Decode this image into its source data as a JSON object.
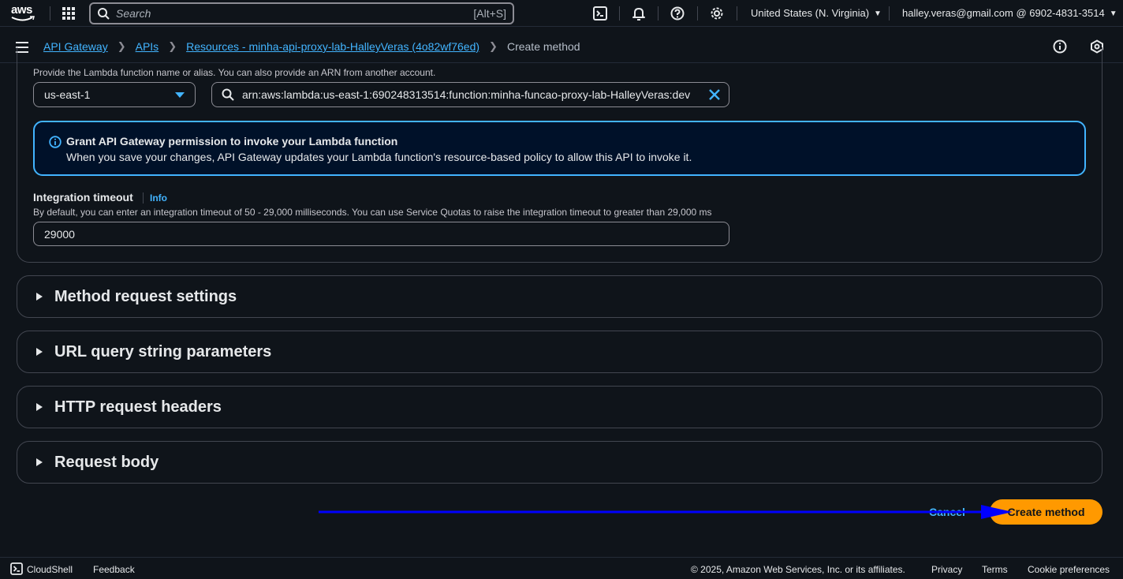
{
  "topnav": {
    "logo": "aws",
    "search_placeholder": "Search",
    "search_shortcut": "[Alt+S]",
    "region": "United States (N. Virginia)",
    "account": "halley.veras@gmail.com @ 6902-4831-3514"
  },
  "breadcrumb": {
    "items": [
      "API Gateway",
      "APIs",
      "Resources - minha-api-proxy-lab-HalleyVeras (4o82wf76ed)"
    ],
    "current": "Create method"
  },
  "lambda": {
    "description": "Provide the Lambda function name or alias. You can also provide an ARN from another account.",
    "region_value": "us-east-1",
    "arn_value": "arn:aws:lambda:us-east-1:690248313514:function:minha-funcao-proxy-lab-HalleyVeras:dev"
  },
  "alert": {
    "title": "Grant API Gateway permission to invoke your Lambda function",
    "body": "When you save your changes, API Gateway updates your Lambda function's resource-based policy to allow this API to invoke it."
  },
  "timeout": {
    "label": "Integration timeout",
    "info": "Info",
    "hint": "By default, you can enter an integration timeout of 50 - 29,000 milliseconds. You can use Service Quotas to raise the integration timeout to greater than 29,000 ms",
    "value": "29000"
  },
  "sections": [
    "Method request settings",
    "URL query string parameters",
    "HTTP request headers",
    "Request body"
  ],
  "actions": {
    "cancel": "Cancel",
    "create": "Create method"
  },
  "footer": {
    "cloudshell": "CloudShell",
    "feedback": "Feedback",
    "copyright": "© 2025, Amazon Web Services, Inc. or its affiliates.",
    "privacy": "Privacy",
    "terms": "Terms",
    "cookies": "Cookie preferences"
  },
  "colors": {
    "accent": "#42b4ff",
    "primary_button": "#ff9900",
    "annotation_arrow": "#0000ff"
  }
}
